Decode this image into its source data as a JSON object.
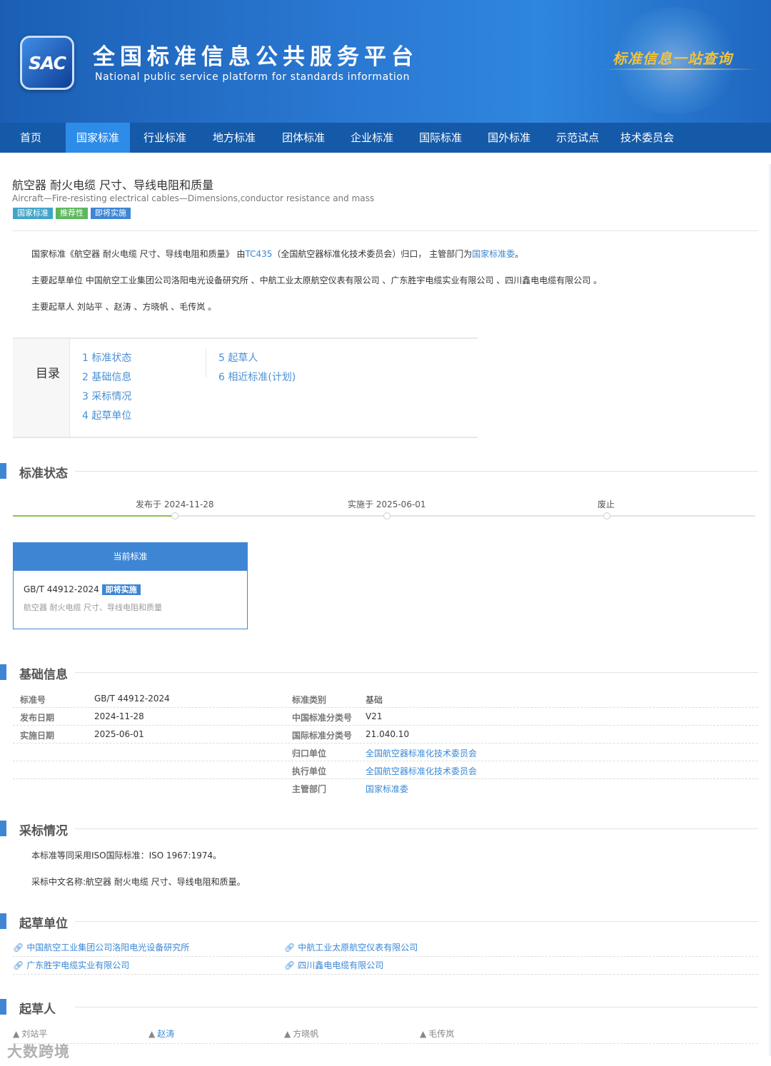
{
  "header": {
    "logo": "SAC",
    "title": "全国标准信息公共服务平台",
    "subtitle": "National public service platform  for standards information",
    "slogan": "标准信息一站查询"
  },
  "nav": [
    "首页",
    "国家标准",
    "行业标准",
    "地方标准",
    "团体标准",
    "企业标准",
    "国际标准",
    "国外标准",
    "示范试点",
    "技术委员会"
  ],
  "standard": {
    "title": "航空器 耐火电缆 尺寸、导线电阻和质量",
    "title_en": "Aircraft—Fire-resisting electrical cables—Dimensions,conductor resistance and mass",
    "badges": [
      "国家标准",
      "推荐性",
      "即将实施"
    ]
  },
  "intro": {
    "line1_a": "国家标准《航空器 耐火电缆 尺寸、导线电阻和质量》 由",
    "line1_tc": "TC435",
    "line1_b": "（全国航空器标准化技术委员会）归口， 主管部门为",
    "line1_dept": "国家标准委",
    "line1_end": "。",
    "line2": "主要起草单位 中国航空工业集团公司洛阳电光设备研究所 、中航工业太原航空仪表有限公司 、广东胜宇电缆实业有限公司 、四川鑫电电缆有限公司 。",
    "line3": "主要起草人 刘站平 、赵涛 、方晓帆 、毛传岚 。"
  },
  "toc": {
    "title": "目录",
    "col1": [
      "1  标准状态",
      "2  基础信息",
      "3  采标情况",
      "4  起草单位"
    ],
    "col2": [
      "5  起草人",
      "6  相近标准(计划)"
    ]
  },
  "sections": {
    "status": "标准状态",
    "basic": "基础信息",
    "adoption": "采标情况",
    "units": "起草单位",
    "people": "起草人"
  },
  "timeline": {
    "published": "发布于 2024-11-28",
    "effective": "实施于 2025-06-01",
    "abolished": "废止",
    "completed_steps": 1
  },
  "current": {
    "header": "当前标准",
    "number": "GB/T 44912-2024",
    "badge": "即将实施",
    "name": "航空器 耐火电缆 尺寸、导线电阻和质量"
  },
  "basic_info": {
    "left": [
      {
        "k": "标准号",
        "v": "GB/T 44912-2024"
      },
      {
        "k": "发布日期",
        "v": "2024-11-28"
      },
      {
        "k": "实施日期",
        "v": "2025-06-01"
      }
    ],
    "right": [
      {
        "k": "标准类别",
        "v": "基础"
      },
      {
        "k": "中国标准分类号",
        "v": "V21"
      },
      {
        "k": "国际标准分类号",
        "v": "21.040.10"
      },
      {
        "k": "归口单位",
        "v": "全国航空器标准化技术委员会"
      },
      {
        "k": "执行单位",
        "v": "全国航空器标准化技术委员会"
      },
      {
        "k": "主管部门",
        "v": "国家标准委"
      }
    ]
  },
  "adoption": {
    "line1": "本标准等同采用ISO国际标准：ISO 1967:1974。",
    "line2": "采标中文名称:航空器 耐火电缆 尺寸、导线电阻和质量。"
  },
  "units": [
    "中国航空工业集团公司洛阳电光设备研究所",
    "中航工业太原航空仪表有限公司",
    "广东胜宇电缆实业有限公司",
    "四川鑫电电缆有限公司"
  ],
  "people": [
    "刘站平",
    "赵涛",
    "方晓帆",
    "毛传岚"
  ],
  "watermark": "大数跨境",
  "colors": {
    "accent": "#3e86d4",
    "nav": "#155aa8",
    "nav_active": "#2d8ce8",
    "done": "#8bc34a"
  }
}
